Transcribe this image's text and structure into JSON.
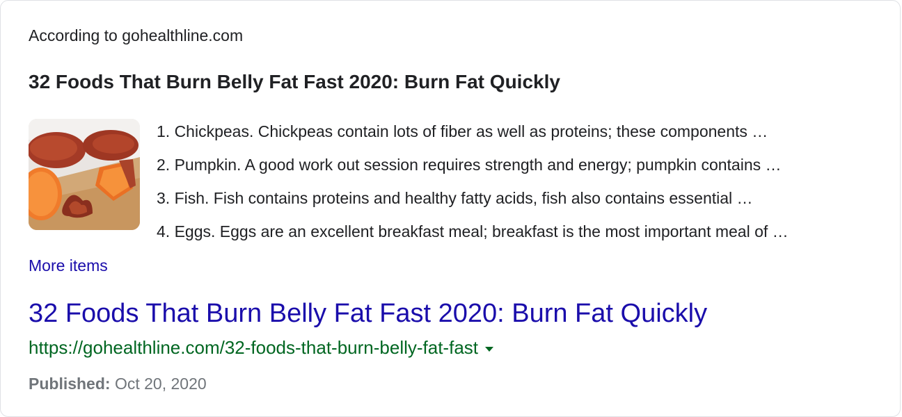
{
  "snippet": {
    "source": "According to gohealthline.com",
    "title": "32 Foods That Burn Belly Fat Fast 2020: Burn Fat Quickly",
    "thumbnail_icon": "sweet-potato-image",
    "items": [
      "1. Chickpeas. Chickpeas contain lots of fiber as well as proteins; these components …",
      "2. Pumpkin. A good work out session requires strength and energy; pumpkin contains …",
      "3. Fish. Fish contains proteins and healthy fatty acids, fish also contains essential …",
      "4. Eggs. Eggs are an excellent breakfast meal; breakfast is the most important meal of …"
    ],
    "more_items": "More items"
  },
  "result": {
    "title": "32 Foods That Burn Belly Fat Fast 2020: Burn Fat Quickly",
    "url": "https://gohealthline.com/32-foods-that-burn-belly-fat-fast",
    "published_label": "Published:",
    "published_date": "Oct 20, 2020"
  },
  "colors": {
    "link": "#1a0dab",
    "url": "#006621",
    "meta": "#70757a",
    "text": "#202124"
  }
}
